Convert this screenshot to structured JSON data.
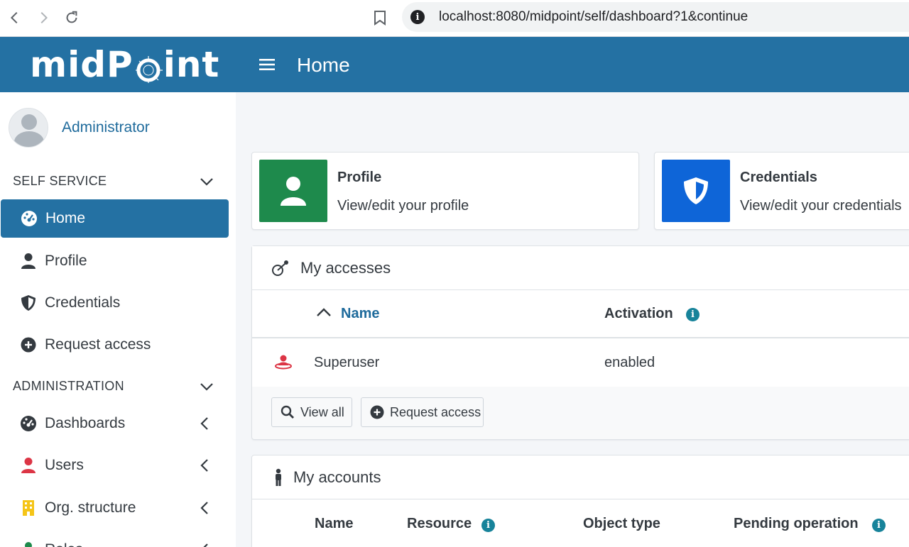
{
  "browser": {
    "url_host": "localhost",
    "url_rest": ":8080/midpoint/self/dashboard?1&continue"
  },
  "header": {
    "logo_pre": "midP",
    "logo_post": "int",
    "title": "Home"
  },
  "sidebar": {
    "user_name": "Administrator",
    "self_service": {
      "label": "SELF SERVICE",
      "items": [
        {
          "label": "Home",
          "icon": "dashboard-icon",
          "active": true
        },
        {
          "label": "Profile",
          "icon": "user-icon"
        },
        {
          "label": "Credentials",
          "icon": "shield-icon"
        },
        {
          "label": "Request access",
          "icon": "plus-circle-icon"
        }
      ]
    },
    "administration": {
      "label": "ADMINISTRATION",
      "items": [
        {
          "label": "Dashboards",
          "icon": "dashboard-icon"
        },
        {
          "label": "Users",
          "icon": "user-icon"
        },
        {
          "label": "Org. structure",
          "icon": "building-icon"
        },
        {
          "label": "Roles",
          "icon": "role-icon"
        }
      ]
    }
  },
  "links": {
    "profile": {
      "title": "Profile",
      "desc": "View/edit your profile",
      "color": "#1e8a4c"
    },
    "credentials": {
      "title": "Credentials",
      "desc": "View/edit your credentials",
      "color": "#0e65d8"
    }
  },
  "my_accesses": {
    "title": "My accesses",
    "columns": {
      "name": "Name",
      "activation": "Activation"
    },
    "rows": [
      {
        "name": "Superuser",
        "activation": "enabled"
      }
    ],
    "buttons": {
      "view_all": "View all",
      "request_access": "Request access"
    }
  },
  "my_accounts": {
    "title": "My accounts",
    "columns": {
      "name": "Name",
      "resource": "Resource",
      "object_type": "Object type",
      "pending_operation": "Pending operation"
    }
  },
  "colors": {
    "header": "#2471a3",
    "active_menu": "#2471a3",
    "link": "#1f6b9c",
    "info": "#17839a",
    "superuser_icon": "#dc3545",
    "users_icon": "#dc3545",
    "org_icon": "#f5c518"
  }
}
